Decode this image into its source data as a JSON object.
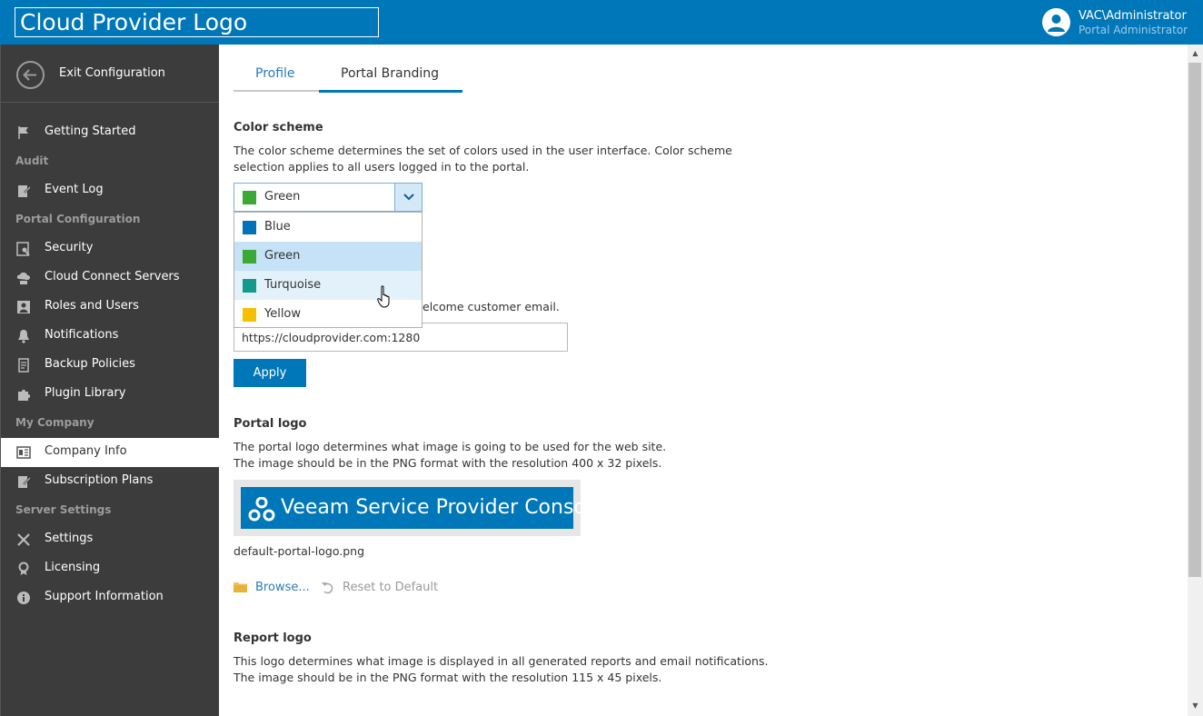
{
  "header": {
    "logo_text": "Cloud Provider Logo",
    "user_name": "VAC\\Administrator",
    "user_role": "Portal Administrator",
    "brand_color": "#0077b8"
  },
  "sidebar": {
    "exit_label": "Exit Configuration",
    "items": [
      {
        "type": "item",
        "label": "Getting Started",
        "icon": "flag-icon"
      },
      {
        "type": "head",
        "label": "Audit"
      },
      {
        "type": "item",
        "label": "Event Log",
        "icon": "event-log-icon"
      },
      {
        "type": "head",
        "label": "Portal Configuration"
      },
      {
        "type": "item",
        "label": "Security",
        "icon": "security-icon"
      },
      {
        "type": "item",
        "label": "Cloud Connect Servers",
        "icon": "cloud-server-icon"
      },
      {
        "type": "item",
        "label": "Roles and Users",
        "icon": "users-icon"
      },
      {
        "type": "item",
        "label": "Notifications",
        "icon": "bell-icon"
      },
      {
        "type": "item",
        "label": "Backup Policies",
        "icon": "policy-icon"
      },
      {
        "type": "item",
        "label": "Plugin Library",
        "icon": "puzzle-icon"
      },
      {
        "type": "head",
        "label": "My Company"
      },
      {
        "type": "item",
        "label": "Company Info",
        "icon": "company-icon",
        "active": true
      },
      {
        "type": "item",
        "label": "Subscription Plans",
        "icon": "subscription-icon"
      },
      {
        "type": "head",
        "label": "Server Settings"
      },
      {
        "type": "item",
        "label": "Settings",
        "icon": "tools-icon"
      },
      {
        "type": "item",
        "label": "Licensing",
        "icon": "license-icon"
      },
      {
        "type": "item",
        "label": "Support Information",
        "icon": "info-icon"
      }
    ]
  },
  "tabs": {
    "profile": "Profile",
    "branding": "Portal Branding",
    "active": "branding"
  },
  "color_scheme": {
    "title": "Color scheme",
    "desc_line1": "The color scheme determines the set of colors used in the user interface. Color scheme",
    "desc_line2": "selection applies to all users logged in to the portal.",
    "selected": "Green",
    "selected_color": "#3aaa35",
    "options": [
      {
        "label": "Blue",
        "color": "#0072b9"
      },
      {
        "label": "Green",
        "color": "#3aaa35",
        "state": "selected"
      },
      {
        "label": "Turquoise",
        "color": "#129b8c",
        "state": "hover"
      },
      {
        "label": "Yellow",
        "color": "#f5c000"
      }
    ]
  },
  "welcome": {
    "desc_visible": "elcome customer email.",
    "url_value": "https://cloudprovider.com:1280",
    "apply_label": "Apply"
  },
  "portal_logo": {
    "title": "Portal logo",
    "desc_line1": "The portal logo determines what image is going to be used for the web site.",
    "desc_line2": "The image should be in the PNG format with the resolution 400 x 32 pixels.",
    "preview_text": "Veeam Service Provider Console",
    "filename": "default-portal-logo.png",
    "browse_label": "Browse...",
    "reset_label": "Reset to Default"
  },
  "report_logo": {
    "title": "Report logo",
    "desc_line1": "This logo determines what image is displayed in all generated reports and email notifications.",
    "desc_line2": "The image should be in the PNG format with the resolution 115 x 45 pixels."
  }
}
